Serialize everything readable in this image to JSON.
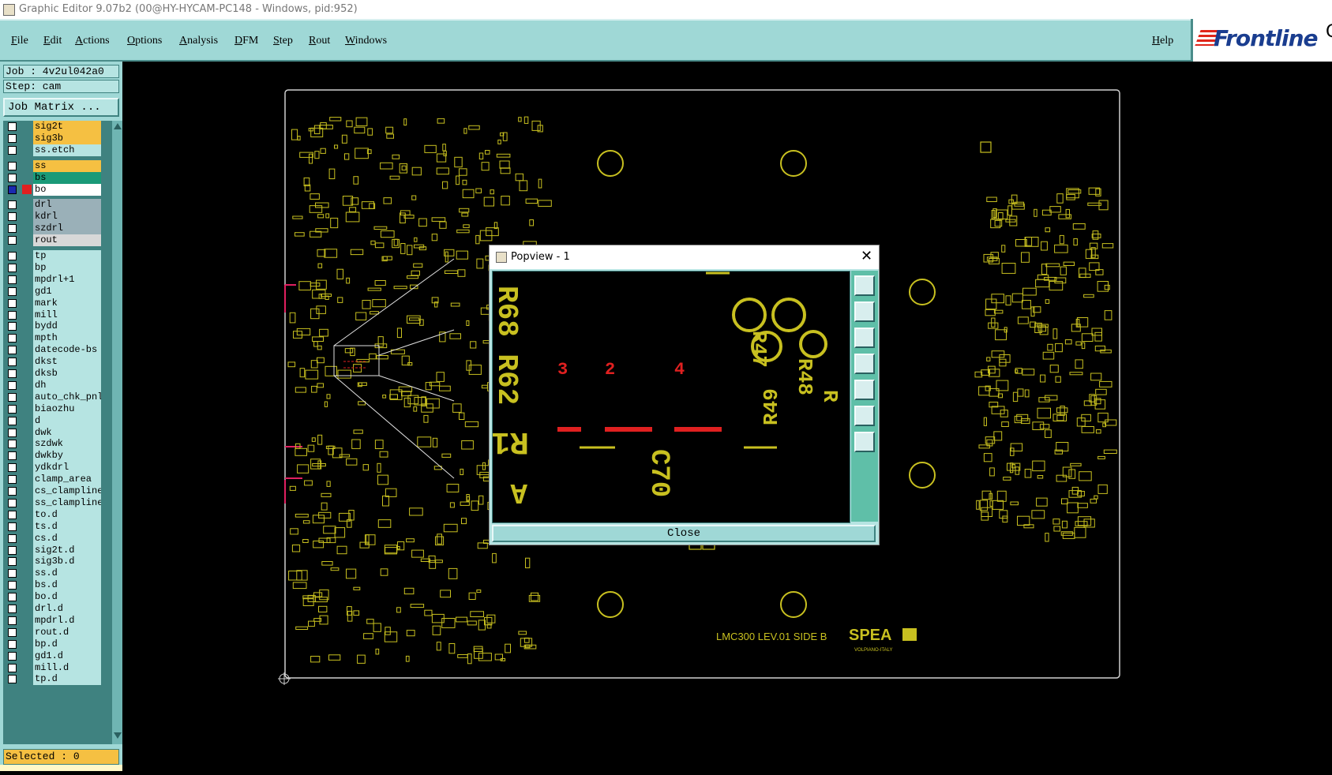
{
  "window": {
    "title": "Graphic Editor 9.07b2 (00@HY-HYCAM-PC148 - Windows, pid:952)"
  },
  "menu": {
    "items": [
      "File",
      "Edit",
      "Actions",
      "Options",
      "Analysis",
      "DFM",
      "Step",
      "Rout",
      "Windows"
    ],
    "help": "Help"
  },
  "logo": {
    "text": "Frontline",
    "cut": "G"
  },
  "job": {
    "job_label": "Job : 4v2ul042a0",
    "step_label": "Step: cam",
    "matrix_button": "Job Matrix ..."
  },
  "layers": [
    {
      "name": "sig2t",
      "color": "#f5c042"
    },
    {
      "name": "sig3b",
      "color": "#f5c042"
    },
    {
      "name": "ss.etch",
      "color": "#b6e4e2"
    },
    {
      "name": "ss",
      "color": "#f5c042"
    },
    {
      "name": "bs",
      "color": "#1a9a78"
    },
    {
      "name": "bo",
      "color": "#ffffff",
      "active": true
    },
    {
      "name": "drl",
      "color": "#9ab0b8"
    },
    {
      "name": "kdrl",
      "color": "#9ab0b8"
    },
    {
      "name": "szdrl",
      "color": "#9ab0b8"
    },
    {
      "name": "rout",
      "color": "#d8d8d8"
    },
    {
      "name": "tp",
      "color": "#b6e4e2"
    },
    {
      "name": "bp",
      "color": "#b6e4e2"
    },
    {
      "name": "mpdrl+1",
      "color": "#b6e4e2"
    },
    {
      "name": "gd1",
      "color": "#b6e4e2"
    },
    {
      "name": "mark",
      "color": "#b6e4e2"
    },
    {
      "name": "mill",
      "color": "#b6e4e2"
    },
    {
      "name": "bydd",
      "color": "#b6e4e2"
    },
    {
      "name": "mpth",
      "color": "#b6e4e2"
    },
    {
      "name": "datecode-bs",
      "color": "#b6e4e2"
    },
    {
      "name": "dkst",
      "color": "#b6e4e2"
    },
    {
      "name": "dksb",
      "color": "#b6e4e2"
    },
    {
      "name": "dh",
      "color": "#b6e4e2"
    },
    {
      "name": "auto_chk_pnl",
      "color": "#b6e4e2"
    },
    {
      "name": "biaozhu",
      "color": "#b6e4e2"
    },
    {
      "name": "d",
      "color": "#b6e4e2"
    },
    {
      "name": "dwk",
      "color": "#b6e4e2"
    },
    {
      "name": "szdwk",
      "color": "#b6e4e2"
    },
    {
      "name": "dwkby",
      "color": "#b6e4e2"
    },
    {
      "name": "ydkdrl",
      "color": "#b6e4e2"
    },
    {
      "name": "clamp_area",
      "color": "#b6e4e2"
    },
    {
      "name": "cs_clampline",
      "color": "#b6e4e2"
    },
    {
      "name": "ss_clampline",
      "color": "#b6e4e2"
    },
    {
      "name": "to.d",
      "color": "#b6e4e2"
    },
    {
      "name": "ts.d",
      "color": "#b6e4e2"
    },
    {
      "name": "cs.d",
      "color": "#b6e4e2"
    },
    {
      "name": "sig2t.d",
      "color": "#b6e4e2"
    },
    {
      "name": "sig3b.d",
      "color": "#b6e4e2"
    },
    {
      "name": "ss.d",
      "color": "#b6e4e2"
    },
    {
      "name": "bs.d",
      "color": "#b6e4e2"
    },
    {
      "name": "bo.d",
      "color": "#b6e4e2"
    },
    {
      "name": "drl.d",
      "color": "#b6e4e2"
    },
    {
      "name": "mpdrl.d",
      "color": "#b6e4e2"
    },
    {
      "name": "rout.d",
      "color": "#b6e4e2"
    },
    {
      "name": "bp.d",
      "color": "#b6e4e2"
    },
    {
      "name": "gd1.d",
      "color": "#b6e4e2"
    },
    {
      "name": "mill.d",
      "color": "#b6e4e2"
    },
    {
      "name": "tp.d",
      "color": "#b6e4e2"
    }
  ],
  "status": {
    "selected": "Selected : 0"
  },
  "board": {
    "labels": {
      "brand": "SPEA",
      "model": "LMC300 LEV.01 SIDE B",
      "origin": "VOLPIANO-ITALY"
    }
  },
  "popview": {
    "title": "Popview - 1",
    "close_label": "Close"
  },
  "colors": {
    "panel": "#9fd8d6",
    "silk": "#c8c020",
    "highlight": "#e02020",
    "orange": "#f5c042"
  }
}
